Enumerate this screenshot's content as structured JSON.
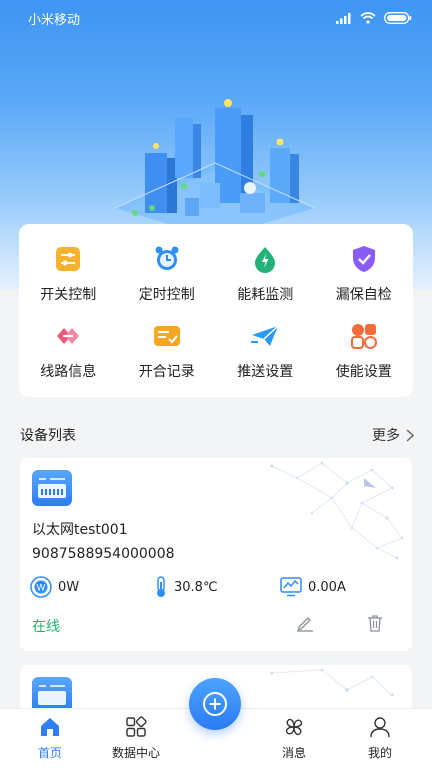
{
  "status_bar": {
    "carrier": "小米移动"
  },
  "menu": {
    "items": [
      {
        "label": "开关控制",
        "icon": "switch-icon",
        "color": "#f6b12e"
      },
      {
        "label": "定时控制",
        "icon": "alarm-clock-icon",
        "color": "#2f8ef5"
      },
      {
        "label": "能耗监测",
        "icon": "energy-drop-icon",
        "color": "#22b27a"
      },
      {
        "label": "漏保自检",
        "icon": "shield-check-icon",
        "color": "#8a5cf6"
      },
      {
        "label": "线路信息",
        "icon": "line-info-icon",
        "color": "#ef5a7a"
      },
      {
        "label": "开合记录",
        "icon": "record-card-icon",
        "color": "#f5a623"
      },
      {
        "label": "推送设置",
        "icon": "push-send-icon",
        "color": "#2b9cf0"
      },
      {
        "label": "使能设置",
        "icon": "enable-settings-icon",
        "color": "#f36b3b"
      }
    ]
  },
  "device_list": {
    "title": "设备列表",
    "more_label": "更多",
    "devices": [
      {
        "name": "以太网test001",
        "serial": "9087588954000008",
        "power": "0W",
        "temperature": "30.8℃",
        "current": "0.00A",
        "status": "在线"
      }
    ]
  },
  "tabbar": {
    "items": [
      {
        "label": "首页",
        "icon": "home-icon",
        "active": true
      },
      {
        "label": "数据中心",
        "icon": "data-center-icon",
        "active": false
      },
      {
        "label": "消息",
        "icon": "clover-message-icon",
        "active": false
      },
      {
        "label": "我的",
        "icon": "profile-icon",
        "active": false
      }
    ]
  },
  "colors": {
    "accent": "#2f7ff6",
    "online": "#1fb36a",
    "background": "#f3f4f6"
  }
}
